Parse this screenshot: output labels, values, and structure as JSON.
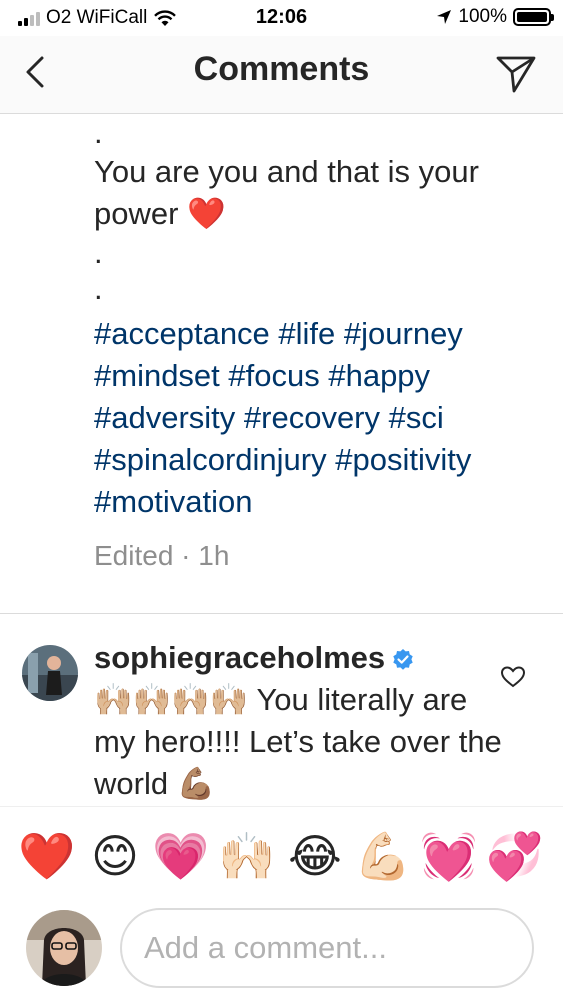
{
  "status_bar": {
    "carrier": "O2 WiFiCall",
    "time": "12:06",
    "battery": "100%",
    "battery_level": 1.0
  },
  "nav": {
    "title": "Comments"
  },
  "caption": {
    "dot1": ".",
    "text": "You are you and that is your power ❤️",
    "dot2": ".",
    "dot3": ".",
    "hashtags": "#acceptance #life #journey #mindset #focus #happy #adversity #recovery #sci #spinalcordinjury #positivity #motivation",
    "meta": "Edited · 1h"
  },
  "comment": {
    "username": "sophiegraceholmes",
    "text": "🙌🏼🙌🏼🙌🏼🙌🏼 You literally are my hero!!!! Let’s take over the world 💪🏽"
  },
  "emoji_bar": [
    "❤️",
    "😊",
    "💗",
    "🙌🏻",
    "😂",
    "💪🏻",
    "💓",
    "💞"
  ],
  "input": {
    "placeholder": "Add a comment..."
  },
  "colors": {
    "hashtag": "#003569",
    "verified": "#3897f0",
    "meta": "#8e8e8e",
    "divider": "#dbdbdb"
  },
  "icons": {
    "back": "chevron-left-icon",
    "share": "paper-plane-icon",
    "verified": "verified-badge-icon",
    "like": "heart-outline-icon",
    "wifi": "wifi-icon",
    "location": "location-arrow-icon",
    "battery": "battery-icon",
    "signal": "signal-bars-icon"
  }
}
